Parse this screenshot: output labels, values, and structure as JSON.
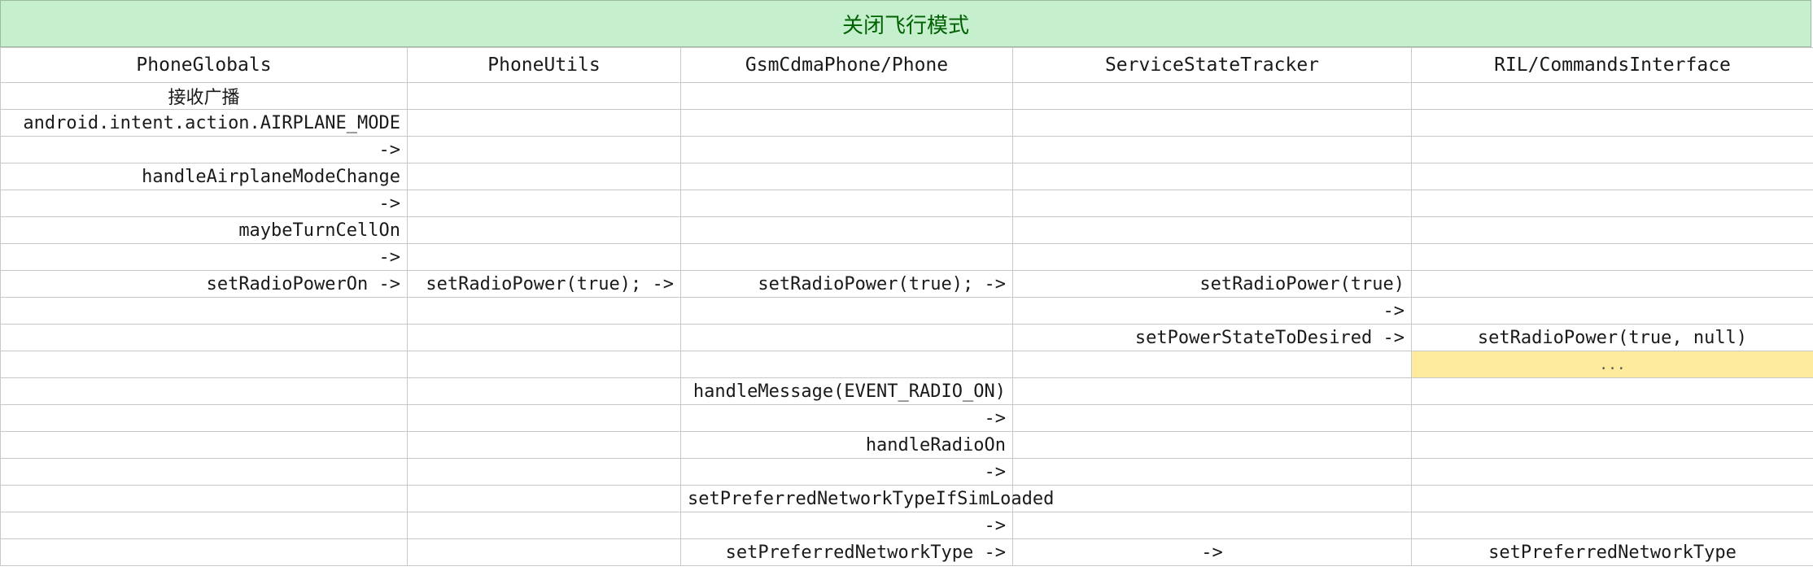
{
  "title": "关闭飞行模式",
  "columns": [
    "PhoneGlobals",
    "PhoneUtils",
    "GsmCdmaPhone/Phone",
    "ServiceStateTracker",
    "RIL/CommandsInterface"
  ],
  "highlight_color": "#ffeb9c",
  "title_bg_color": "#c6efce",
  "rows": [
    [
      {
        "t": "接收广播",
        "a": "center",
        "cjk": true
      },
      {
        "t": ""
      },
      {
        "t": ""
      },
      {
        "t": ""
      },
      {
        "t": ""
      }
    ],
    [
      {
        "t": "android.intent.action.AIRPLANE_MODE"
      },
      {
        "t": ""
      },
      {
        "t": ""
      },
      {
        "t": ""
      },
      {
        "t": ""
      }
    ],
    [
      {
        "t": "->"
      },
      {
        "t": ""
      },
      {
        "t": ""
      },
      {
        "t": ""
      },
      {
        "t": ""
      }
    ],
    [
      {
        "t": "handleAirplaneModeChange"
      },
      {
        "t": ""
      },
      {
        "t": ""
      },
      {
        "t": ""
      },
      {
        "t": ""
      }
    ],
    [
      {
        "t": "->"
      },
      {
        "t": ""
      },
      {
        "t": ""
      },
      {
        "t": ""
      },
      {
        "t": ""
      }
    ],
    [
      {
        "t": "maybeTurnCellOn"
      },
      {
        "t": ""
      },
      {
        "t": ""
      },
      {
        "t": ""
      },
      {
        "t": ""
      }
    ],
    [
      {
        "t": "->"
      },
      {
        "t": ""
      },
      {
        "t": ""
      },
      {
        "t": ""
      },
      {
        "t": ""
      }
    ],
    [
      {
        "t": "setRadioPowerOn ->"
      },
      {
        "t": "setRadioPower(true); ->"
      },
      {
        "t": "setRadioPower(true); ->"
      },
      {
        "t": "setRadioPower(true)"
      },
      {
        "t": ""
      }
    ],
    [
      {
        "t": ""
      },
      {
        "t": ""
      },
      {
        "t": ""
      },
      {
        "t": "->"
      },
      {
        "t": ""
      }
    ],
    [
      {
        "t": ""
      },
      {
        "t": ""
      },
      {
        "t": ""
      },
      {
        "t": "setPowerStateToDesired ->"
      },
      {
        "t": "setRadioPower(true, null)",
        "a": "center"
      }
    ],
    [
      {
        "t": ""
      },
      {
        "t": ""
      },
      {
        "t": ""
      },
      {
        "t": ""
      },
      {
        "t": "...",
        "hl": true
      }
    ],
    [
      {
        "t": ""
      },
      {
        "t": ""
      },
      {
        "t": "handleMessage(EVENT_RADIO_ON)"
      },
      {
        "t": ""
      },
      {
        "t": ""
      }
    ],
    [
      {
        "t": ""
      },
      {
        "t": ""
      },
      {
        "t": "->"
      },
      {
        "t": ""
      },
      {
        "t": ""
      }
    ],
    [
      {
        "t": ""
      },
      {
        "t": ""
      },
      {
        "t": "handleRadioOn"
      },
      {
        "t": ""
      },
      {
        "t": ""
      }
    ],
    [
      {
        "t": ""
      },
      {
        "t": ""
      },
      {
        "t": "->"
      },
      {
        "t": ""
      },
      {
        "t": ""
      }
    ],
    [
      {
        "t": ""
      },
      {
        "t": ""
      },
      {
        "t": "setPreferredNetworkTypeIfSimLoaded"
      },
      {
        "t": ""
      },
      {
        "t": ""
      }
    ],
    [
      {
        "t": ""
      },
      {
        "t": ""
      },
      {
        "t": "->"
      },
      {
        "t": ""
      },
      {
        "t": ""
      }
    ],
    [
      {
        "t": ""
      },
      {
        "t": ""
      },
      {
        "t": "setPreferredNetworkType ->"
      },
      {
        "t": "->",
        "a": "center"
      },
      {
        "t": "setPreferredNetworkType",
        "a": "center"
      }
    ]
  ]
}
